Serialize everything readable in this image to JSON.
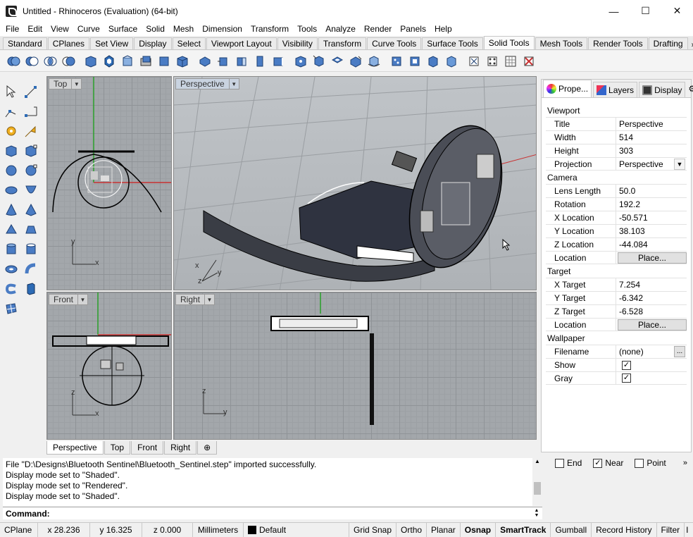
{
  "window": {
    "title": "Untitled - Rhinoceros (Evaluation) (64-bit)"
  },
  "menu": [
    "File",
    "Edit",
    "View",
    "Curve",
    "Surface",
    "Solid",
    "Mesh",
    "Dimension",
    "Transform",
    "Tools",
    "Analyze",
    "Render",
    "Panels",
    "Help"
  ],
  "toolbar_tabs": [
    "Standard",
    "CPlanes",
    "Set View",
    "Display",
    "Select",
    "Viewport Layout",
    "Visibility",
    "Transform",
    "Curve Tools",
    "Surface Tools",
    "Solid Tools",
    "Mesh Tools",
    "Render Tools",
    "Drafting"
  ],
  "toolbar_tabs_active": "Solid Tools",
  "toolbar_more": "»",
  "viewports": {
    "top": "Top",
    "perspective": "Perspective",
    "front": "Front",
    "right": "Right"
  },
  "axes": {
    "x": "x",
    "y": "y",
    "z": "z"
  },
  "viewport_tabs": [
    "Perspective",
    "Top",
    "Front",
    "Right"
  ],
  "viewport_tab_add": "⊕",
  "panel": {
    "tabs": [
      "Prope...",
      "Layers",
      "Display"
    ],
    "sections": {
      "viewport": "Viewport",
      "camera": "Camera",
      "target": "Target",
      "wallpaper": "Wallpaper"
    },
    "viewport": {
      "title_label": "Title",
      "title": "Perspective",
      "width_label": "Width",
      "width": "514",
      "height_label": "Height",
      "height": "303",
      "projection_label": "Projection",
      "projection": "Perspective"
    },
    "camera": {
      "lens_label": "Lens Length",
      "lens": "50.0",
      "rotation_label": "Rotation",
      "rotation": "192.2",
      "x_label": "X Location",
      "x": "-50.571",
      "y_label": "Y Location",
      "y": "38.103",
      "z_label": "Z Location",
      "z": "-44.084",
      "location_label": "Location",
      "place": "Place..."
    },
    "target": {
      "x_label": "X Target",
      "x": "7.254",
      "y_label": "Y Target",
      "y": "-6.342",
      "z_label": "Z Target",
      "z": "-6.528",
      "location_label": "Location",
      "place": "Place..."
    },
    "wallpaper": {
      "filename_label": "Filename",
      "filename": "(none)",
      "show_label": "Show",
      "show": true,
      "gray_label": "Gray",
      "gray": true
    }
  },
  "history": [
    "File \"D:\\Designs\\Bluetooth Sentinel\\Bluetooth_Sentinel.step\" imported successfully.",
    "Display mode set to \"Shaded\".",
    "Display mode set to \"Rendered\".",
    "Display mode set to \"Shaded\"."
  ],
  "command_label": "Command:",
  "osnap": {
    "end": "End",
    "end_checked": false,
    "near": "Near",
    "near_checked": true,
    "point": "Point",
    "point_checked": false,
    "more": "»"
  },
  "status": {
    "cplane": "CPlane",
    "x": "x 28.236",
    "y": "y 16.325",
    "z": "z 0.000",
    "units": "Millimeters",
    "layer": "Default",
    "grid_snap": "Grid Snap",
    "ortho": "Ortho",
    "planar": "Planar",
    "osnap": "Osnap",
    "smarttrack": "SmartTrack",
    "gumball": "Gumball",
    "record_history": "Record History",
    "filter": "Filter",
    "last": "I"
  },
  "colors": {
    "accent": "#d7e4f2",
    "x_axis": "#c83232",
    "y_axis": "#32a032",
    "solid_tools_blue": "#2d6bb5"
  }
}
